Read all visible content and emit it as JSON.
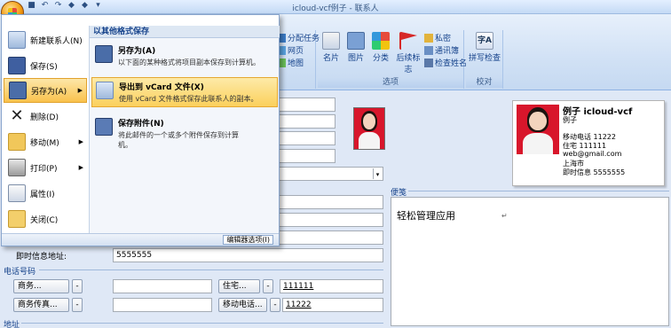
{
  "window": {
    "title": "icloud-vcf例子 - 联系人"
  },
  "qat": {
    "icons": [
      "save-icon",
      "undo-icon",
      "redo-icon",
      "up-icon",
      "down-icon",
      "customize-icon"
    ]
  },
  "ribbon": {
    "show_group": {
      "items": [
        "分配任务",
        "网页",
        "地图"
      ]
    },
    "options_group": {
      "label": "选项",
      "business_card": "名片",
      "picture": "图片",
      "categorize": "分类",
      "follow_up": "后续标志",
      "private": "私密",
      "address_book": "通讯簿",
      "check_names": "检查姓名"
    },
    "proofing_group": {
      "label": "校对",
      "spelling": "拼写检查"
    }
  },
  "menu": {
    "items": [
      {
        "label": "新建联系人(N)"
      },
      {
        "label": "保存(S)"
      },
      {
        "label": "另存为(A)"
      },
      {
        "label": "删除(D)"
      },
      {
        "label": "移动(M)"
      },
      {
        "label": "打印(P)"
      },
      {
        "label": "属性(I)"
      },
      {
        "label": "关闭(C)"
      }
    ],
    "submenu_title": "以其他格式保存",
    "submenu": [
      {
        "title": "另存为(A)",
        "desc": "以下面的某种格式将项目副本保存到计算机。"
      },
      {
        "title": "导出到 vCard 文件(X)",
        "desc": "使用 vCard 文件格式保存此联系人的副本。"
      },
      {
        "title": "保存附件(N)",
        "desc": "将此邮件的一个或多个附件保存到计算机。"
      }
    ],
    "editor_options": "编辑器选项(I)"
  },
  "form": {
    "im_label": "即时信息地址:",
    "im_value": "5555555",
    "phone_section": "电话号码",
    "address_section": "地址",
    "notes_label": "便笺",
    "phones": [
      {
        "type": "商务...",
        "value": ""
      },
      {
        "type": "住宅...",
        "value": "111111"
      },
      {
        "type": "商务传真...",
        "value": ""
      },
      {
        "type": "移动电话...",
        "value": "11222"
      }
    ],
    "notes_text": "轻松管理应用"
  },
  "card": {
    "name": "例子 icloud-vcf",
    "subname": "例子",
    "mobile": "移动电话 11222",
    "home": "住宅 111111",
    "email": "web@gmail.com",
    "city": "上海市",
    "im": "即时信息 5555555"
  }
}
